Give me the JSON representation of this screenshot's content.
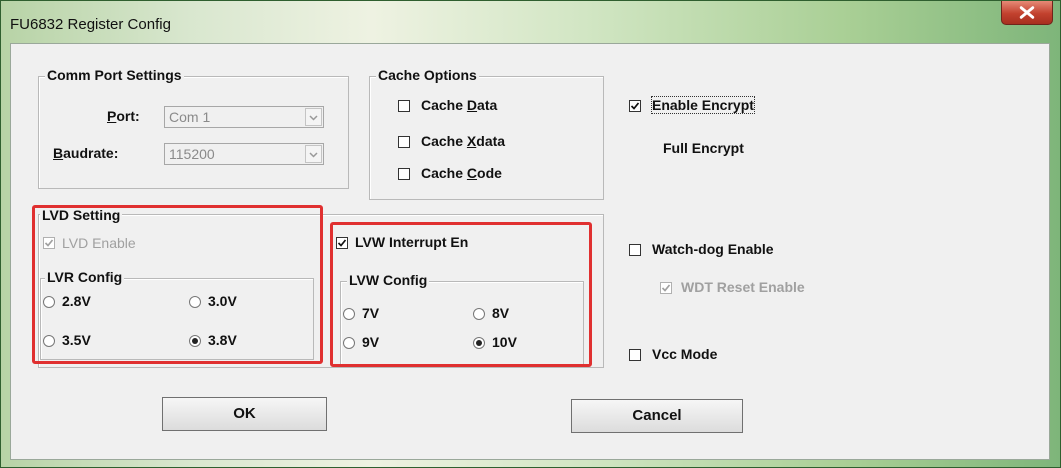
{
  "window": {
    "title": "FU6832 Register Config"
  },
  "comm": {
    "legend": "Comm Port Settings",
    "port_label": "Port:",
    "port_value": "Com 1",
    "baud_label": "Baudrate:",
    "baud_value": "115200"
  },
  "cache": {
    "legend": "Cache Options",
    "items": [
      {
        "label": "Cache Data",
        "checked": false
      },
      {
        "label": "Cache Xdata",
        "checked": false
      },
      {
        "label": "Cache Code",
        "checked": false
      }
    ]
  },
  "encrypt": {
    "enable_label": "Enable Encrypt",
    "checked": true,
    "mode_text": "Full Encrypt"
  },
  "lvd": {
    "legend": "LVD Setting",
    "enable_label": "LVD Enable",
    "enable_checked": true,
    "lvr_legend": "LVR Config",
    "options": [
      "2.8V",
      "3.0V",
      "3.5V",
      "3.8V"
    ],
    "selected": "3.8V"
  },
  "lvw": {
    "interrupt_label": "LVW Interrupt En",
    "interrupt_checked": true,
    "legend": "LVW Config",
    "options": [
      "7V",
      "8V",
      "9V",
      "10V"
    ],
    "selected": "10V"
  },
  "watchdog": {
    "enable_label": "Watch-dog Enable",
    "enable_checked": false,
    "wdt_reset_label": "WDT Reset Enable",
    "wdt_reset_checked": true
  },
  "vcc": {
    "label": "Vcc Mode",
    "checked": false
  },
  "buttons": {
    "ok": "OK",
    "cancel": "Cancel"
  },
  "colors": {
    "highlight": "#e03030",
    "title_bar": "#b7d3a6",
    "close_button": "#c2412e"
  }
}
